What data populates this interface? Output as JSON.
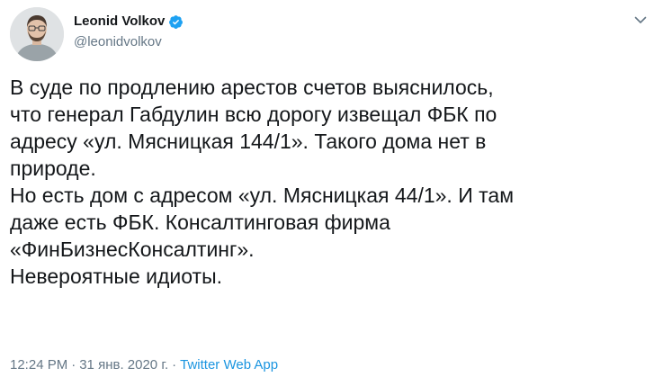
{
  "author": {
    "display_name": "Leonid Volkov",
    "handle": "@leonidvolkov",
    "verified": true
  },
  "tweet": {
    "lines": [
      "В суде по продлению арестов счетов выяснилось,",
      "что генерал Габдулин всю дорогу извещал ФБК по",
      "адресу «ул. Мясницкая 144/1». Такого дома нет в",
      "природе.",
      "Но есть дом с адресом «ул. Мясницкая 44/1». И там",
      "даже есть ФБК. Консалтинговая фирма",
      "«ФинБизнесКонсалтинг».",
      "Невероятные идиоты."
    ],
    "time": "12:24 PM",
    "separator": "·",
    "date": "31 янв. 2020 г.",
    "source": "Twitter Web App"
  },
  "icons": {
    "verified": "verified-badge-icon",
    "menu": "chevron-down-icon"
  },
  "colors": {
    "text": "#14171a",
    "secondary": "#657786",
    "link": "#1b95e0",
    "verified": "#1da1f2"
  }
}
